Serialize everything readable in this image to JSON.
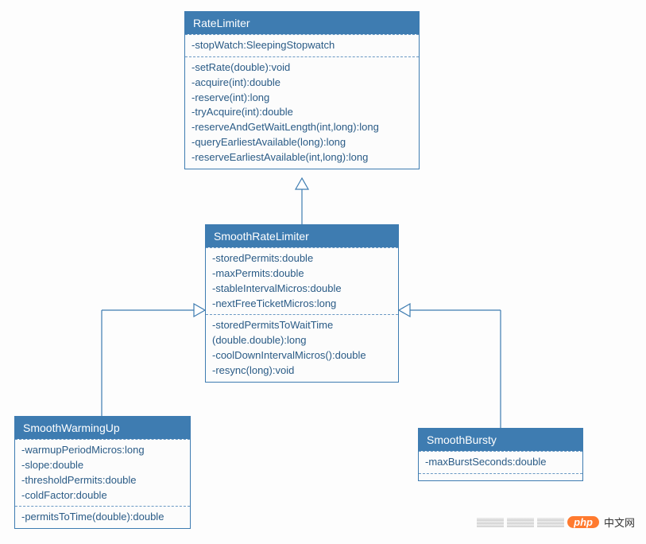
{
  "classes": {
    "rateLimiter": {
      "name": "RateLimiter",
      "attrs": [
        "-stopWatch:SleepingStopwatch"
      ],
      "ops": [
        "-setRate(double):void",
        "-acquire(int):double",
        "-reserve(int):long",
        "-tryAcquire(int):double",
        "-reserveAndGetWaitLength(int,long):long",
        "-queryEarliestAvailable(long):long",
        "-reserveEarliestAvailable(int,long):long"
      ]
    },
    "smoothRateLimiter": {
      "name": "SmoothRateLimiter",
      "attrs": [
        "-storedPermits:double",
        "-maxPermits:double",
        "-stableIntervalMicros:double",
        "-nextFreeTicketMicros:long"
      ],
      "ops": [
        "-storedPermitsToWaitTime",
        "(double.double):long",
        "-coolDownIntervalMicros():double",
        "-resync(long):void"
      ]
    },
    "smoothWarmingUp": {
      "name": "SmoothWarmingUp",
      "attrs": [
        "-warmupPeriodMicros:long",
        "-slope:double",
        "-thresholdPermits:double",
        "-coldFactor:double"
      ],
      "ops": [
        "-permitsToTime(double):double"
      ]
    },
    "smoothBursty": {
      "name": "SmoothBursty",
      "attrs": [
        "-maxBurstSeconds:double"
      ],
      "ops": []
    }
  },
  "watermark": {
    "pill": "php",
    "text": "中文网"
  }
}
